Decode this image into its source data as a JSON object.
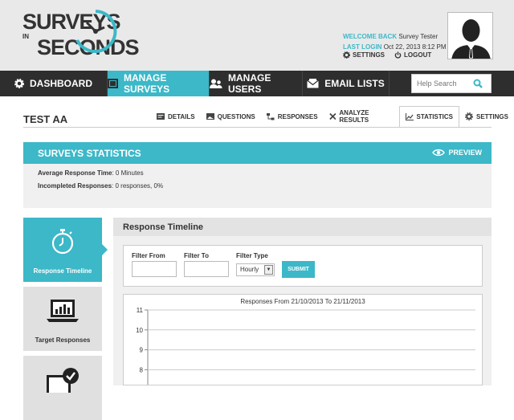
{
  "brand": {
    "line1": "SURVEYS",
    "line_in": "IN",
    "line2": "SECONDS"
  },
  "user": {
    "welcome_label": "WELCOME BACK",
    "name": "Survey Tester",
    "last_login_label": "LAST LOGIN",
    "last_login_value": "Oct 22, 2013 8:12 PM",
    "settings_label": "SETTINGS",
    "logout_label": "LOGOUT"
  },
  "nav": {
    "items": [
      {
        "label": "DASHBOARD",
        "icon": "gear-icon"
      },
      {
        "label": "MANAGE SURVEYS",
        "icon": "survey-icon"
      },
      {
        "label": "MANAGE USERS",
        "icon": "users-icon"
      },
      {
        "label": "EMAIL LISTS",
        "icon": "email-icon"
      }
    ],
    "search_placeholder": "Help Search"
  },
  "page": {
    "title": "TEST AA",
    "tabs": [
      {
        "label": "DETAILS",
        "icon": "details-icon"
      },
      {
        "label": "QUESTIONS",
        "icon": "questions-icon"
      },
      {
        "label": "RESPONSES",
        "icon": "responses-icon"
      },
      {
        "label": "ANALYZE RESULTS",
        "icon": "tools-icon"
      },
      {
        "label": "STATISTICS",
        "icon": "chart-icon"
      },
      {
        "label": "SETTINGS",
        "icon": "gear-icon"
      }
    ]
  },
  "stats": {
    "title": "SURVEYS STATISTICS",
    "preview_label": "PREVIEW",
    "avg_label": "Average Response Time",
    "avg_value": ": 0 Minutes",
    "incomplete_label": "Incompleted Responses",
    "incomplete_value": ": 0 responses, 0%"
  },
  "side": {
    "items": [
      {
        "label": "Response Timeline",
        "icon": "stopwatch-icon"
      },
      {
        "label": "Target Responses",
        "icon": "monitor-chart-icon"
      },
      {
        "label": "",
        "icon": "monitor-check-icon"
      }
    ]
  },
  "timeline": {
    "title": "Response Timeline",
    "filter_from_label": "Filter From",
    "filter_to_label": "Filter To",
    "filter_type_label": "Filter Type",
    "filter_type_value": "Hourly",
    "submit_label": "SUBMIT"
  },
  "chart_data": {
    "type": "line",
    "title": "Responses From 21/10/2013 To 21/11/2013",
    "xlabel": "",
    "ylabel": "",
    "y_ticks": [
      11,
      10,
      9,
      8
    ],
    "ylim": [
      7.25,
      11
    ],
    "grid": true,
    "series": []
  },
  "colors": {
    "accent": "#3cb8c8",
    "nav_bg": "#2e2e2e",
    "header_bg": "#e9e9e9"
  }
}
